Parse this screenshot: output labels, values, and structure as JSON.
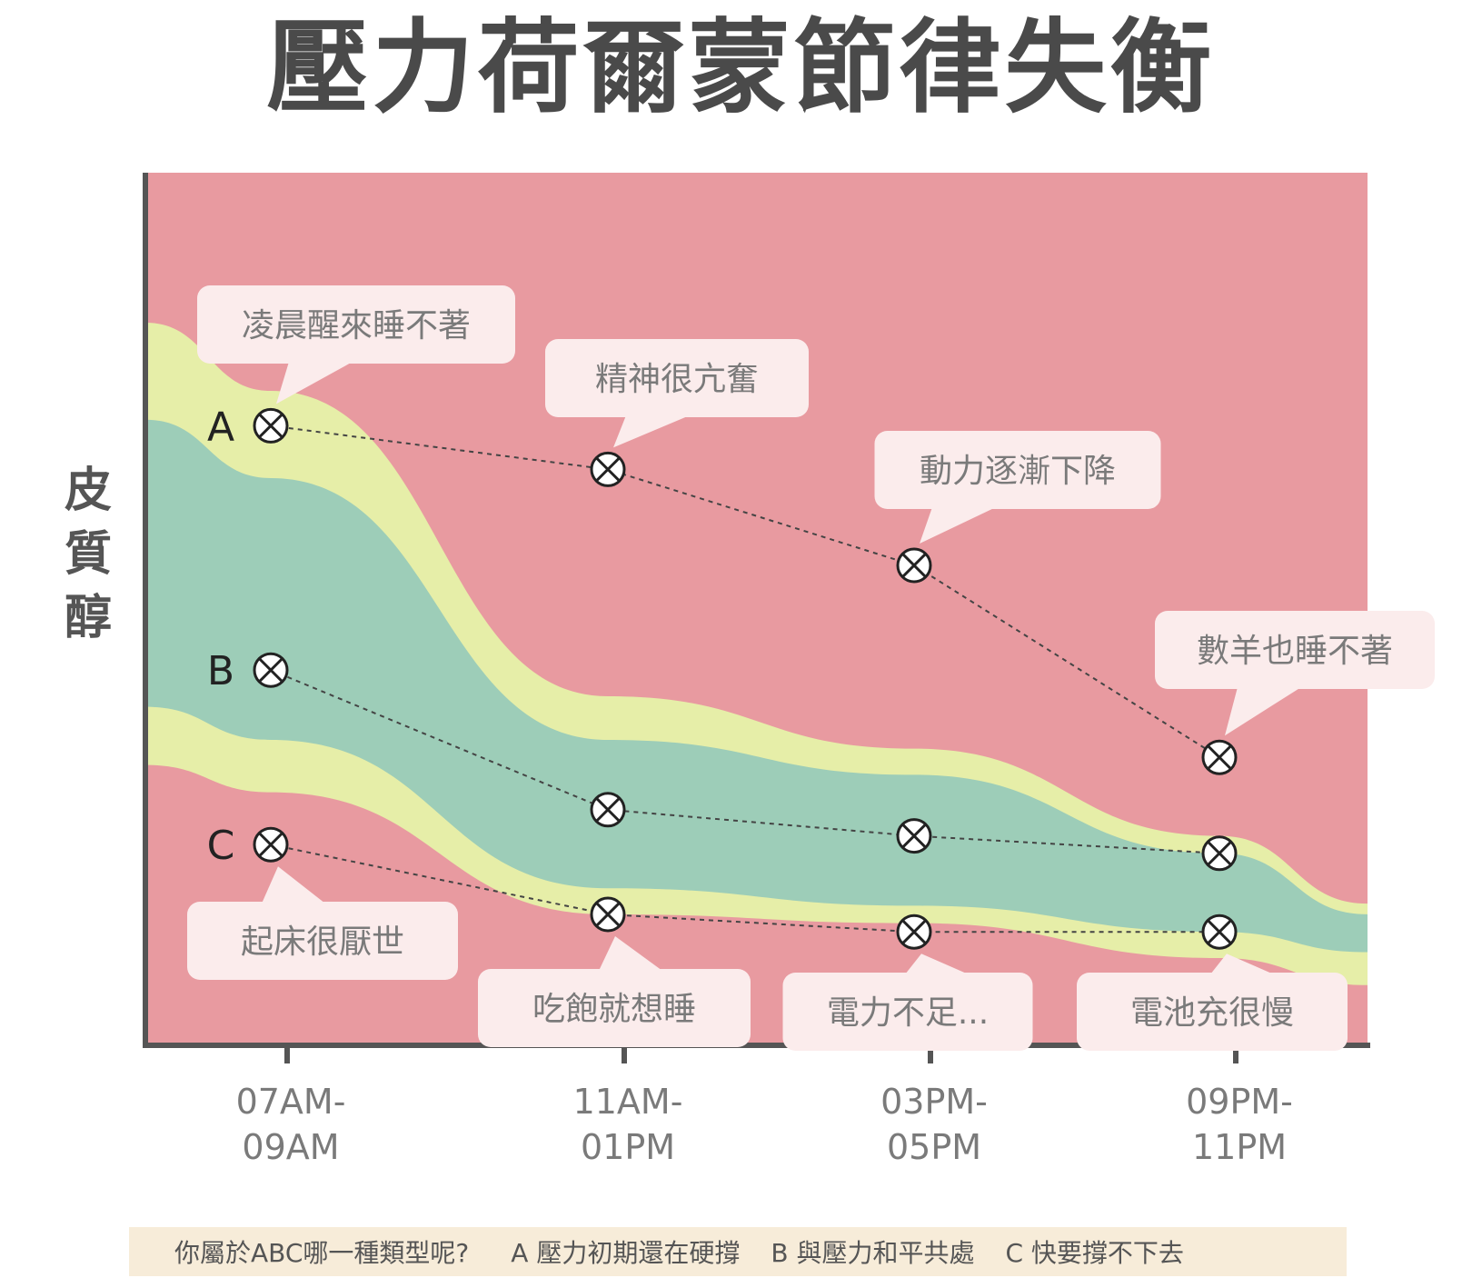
{
  "title": "壓力荷爾蒙節律失衡",
  "chart_data": {
    "type": "line",
    "ylabel": "皮質醇",
    "categories": [
      "07AM-\n09AM",
      "11AM-\n01PM",
      "03PM-\n05PM",
      "09PM-\n11PM"
    ],
    "ylim": [
      0,
      100
    ],
    "series": [
      {
        "name": "A",
        "values": [
          71,
          66,
          55,
          33
        ],
        "annotations": [
          "凌晨醒來睡不著",
          "精神很亢奮",
          "動力逐漸下降",
          "數羊也睡不著"
        ]
      },
      {
        "name": "B",
        "values": [
          43,
          27,
          24,
          22
        ]
      },
      {
        "name": "C",
        "values": [
          23,
          15,
          13,
          13
        ],
        "annotations": [
          "起床很厭世",
          "吃飽就想睡",
          "電力不足...",
          "電池充很慢"
        ]
      }
    ],
    "bands": {
      "yellow_top": [
        75,
        40,
        34,
        24
      ],
      "green_top": [
        65,
        35,
        31,
        22
      ],
      "green_bottom": [
        35,
        18,
        16,
        13
      ],
      "yellow_bottom": [
        29,
        15,
        14,
        10
      ]
    },
    "colors": {
      "background": "#e89aa0",
      "yellow": "#e6eea8",
      "green": "#9dcdb8",
      "axis": "#555555",
      "bubble": "#fbecec"
    }
  },
  "footer": {
    "question": "你屬於ABC哪一種類型呢?",
    "option_a": "A 壓力初期還在硬撐",
    "option_b": "B 與壓力和平共處",
    "option_c": "C 快要撐不下去"
  }
}
